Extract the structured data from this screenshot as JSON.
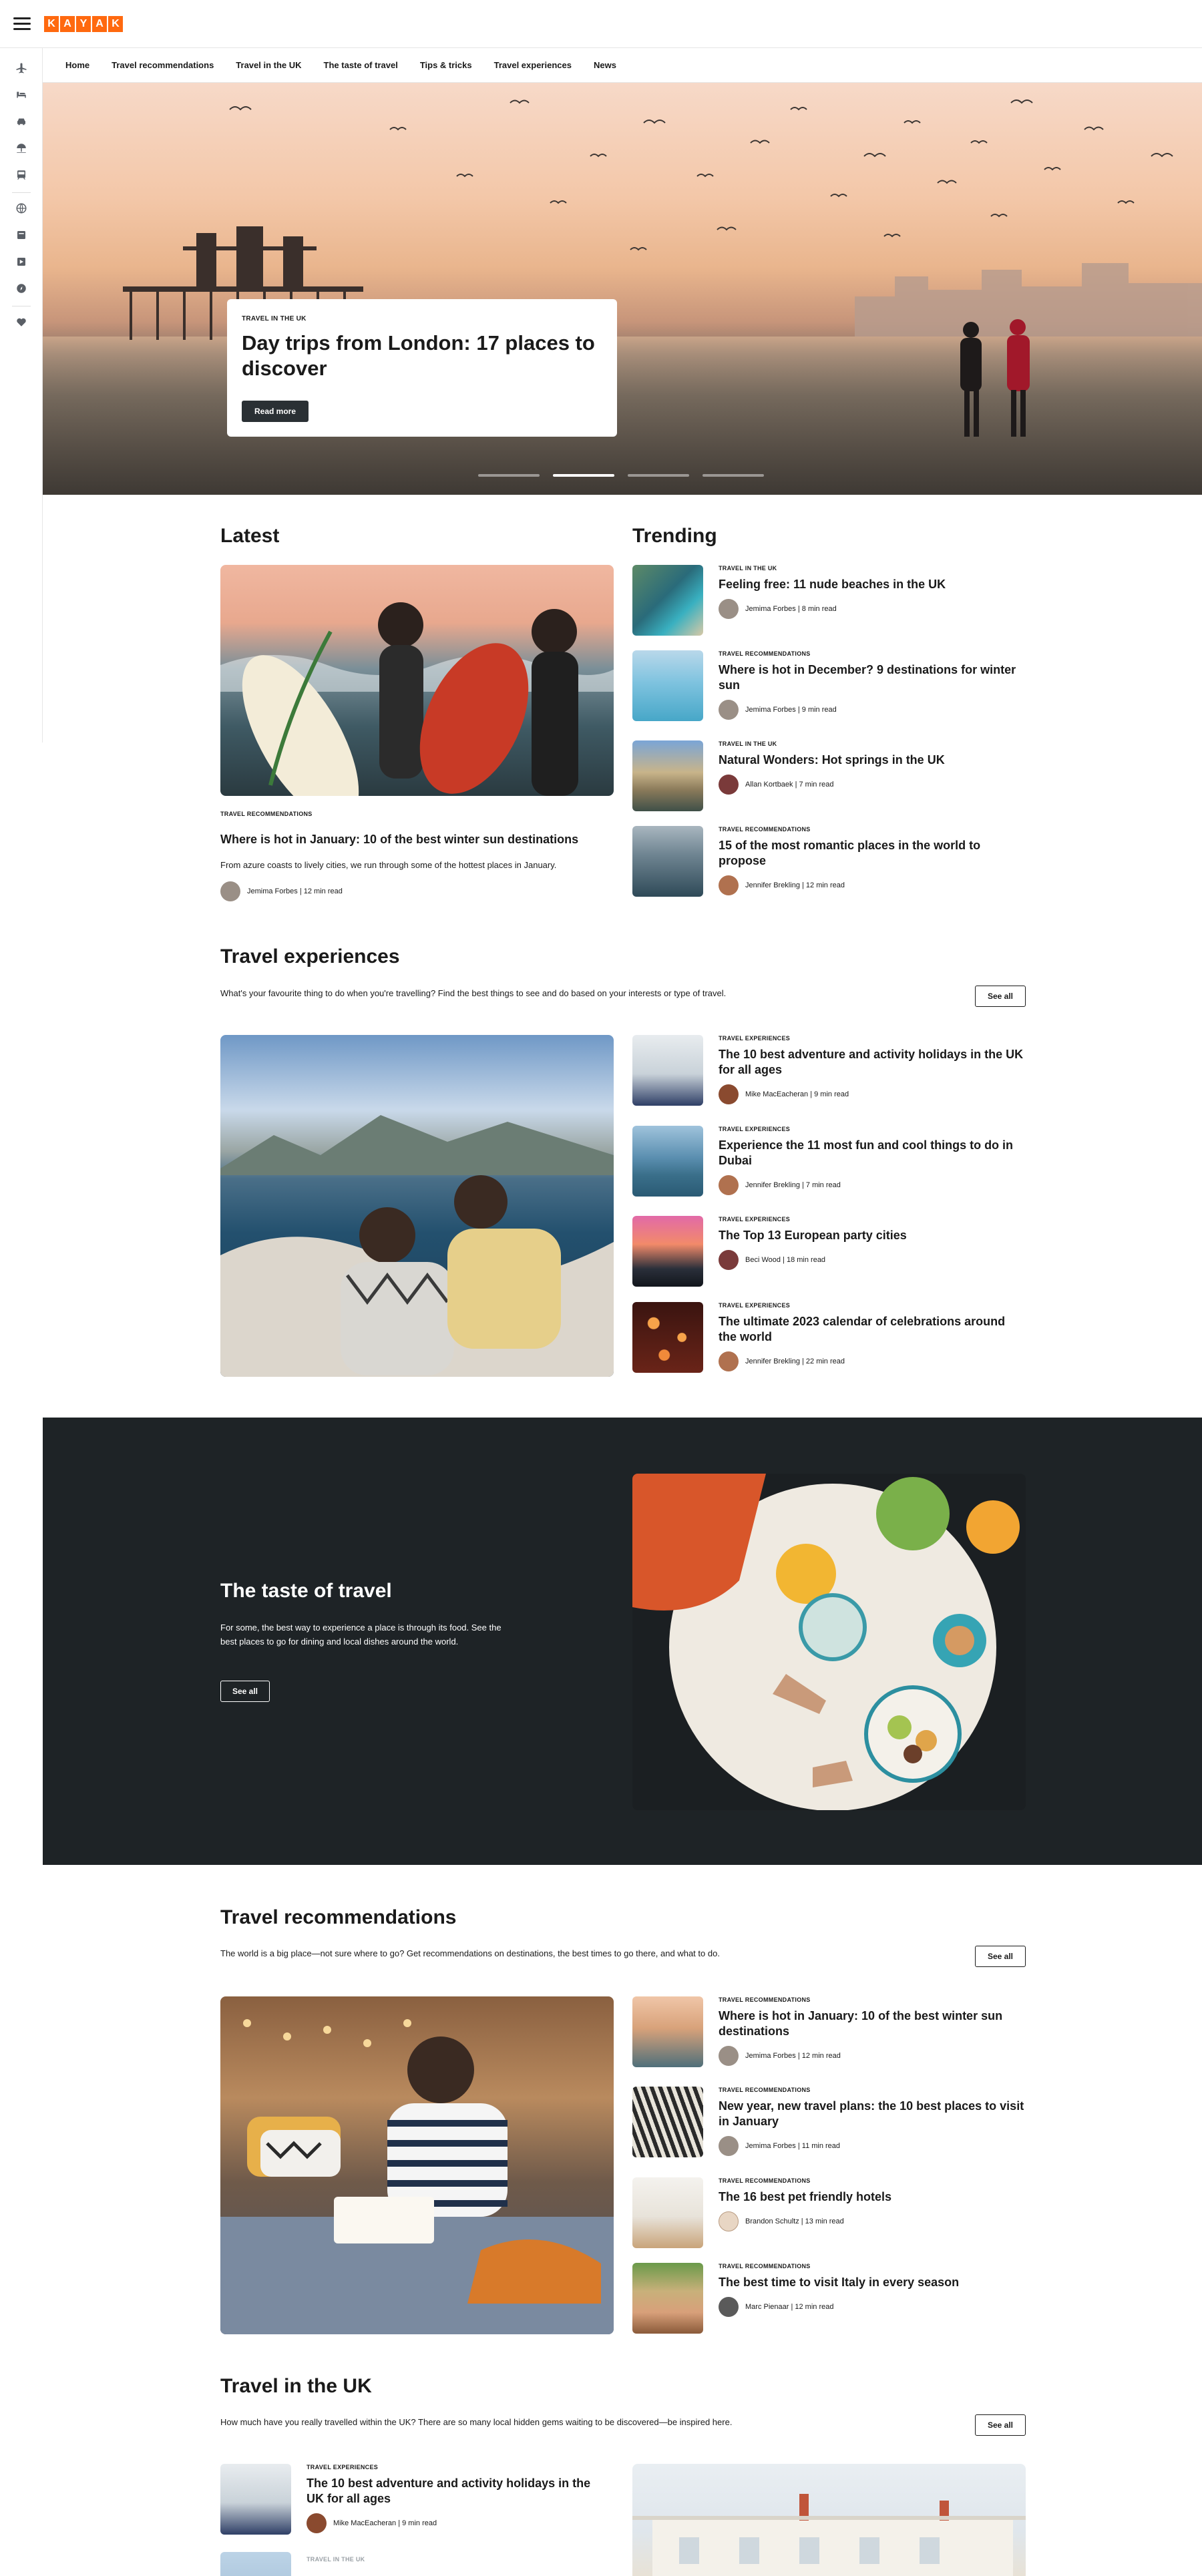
{
  "brand": {
    "letters": [
      "K",
      "A",
      "Y",
      "A",
      "K"
    ],
    "color": "#ff690f"
  },
  "rail_icons": [
    "plane-icon",
    "hotel-icon",
    "car-icon",
    "beach-icon",
    "train-icon",
    "globe-icon",
    "trips-icon",
    "explore-icon",
    "compass-icon",
    "heart-icon"
  ],
  "subnav": [
    "Home",
    "Travel recommendations",
    "Travel in the UK",
    "The taste of travel",
    "Tips & tricks",
    "Travel experiences",
    "News"
  ],
  "hero": {
    "kicker": "TRAVEL IN THE UK",
    "title": "Day trips from London: 17 places to discover",
    "button": "Read more",
    "slides": 4,
    "active_slide": 2
  },
  "latest": {
    "heading": "Latest",
    "kicker": "TRAVEL RECOMMENDATIONS",
    "title": "Where is hot in January: 10 of the best winter sun destinations",
    "desc": "From azure coasts to lively cities, we run through some of the hottest places in January.",
    "meta": "Jemima Forbes | 12 min read"
  },
  "trending": {
    "heading": "Trending",
    "items": [
      {
        "kicker": "TRAVEL IN THE UK",
        "title": "Feeling free: 11 nude beaches in the UK",
        "meta": "Jemima Forbes | 8 min read"
      },
      {
        "kicker": "TRAVEL RECOMMENDATIONS",
        "title": "Where is hot in December? 9 destinations for winter sun",
        "meta": "Jemima Forbes | 9 min read"
      },
      {
        "kicker": "TRAVEL IN THE UK",
        "title": "Natural Wonders: Hot springs in the UK",
        "meta": "Allan Kortbaek | 7 min read"
      },
      {
        "kicker": "TRAVEL RECOMMENDATIONS",
        "title": "15 of the most romantic places in the world to propose",
        "meta": "Jennifer Brekling | 12 min read"
      }
    ]
  },
  "experiences": {
    "heading": "Travel experiences",
    "intro": "What's your favourite thing to do when you're travelling? Find the best things to see and do based on your interests or type of travel.",
    "see_all": "See all",
    "items": [
      {
        "kicker": "TRAVEL EXPERIENCES",
        "title": "The 10 best adventure and activity holidays in the UK for all ages",
        "meta": "Mike MacEacheran | 9 min read"
      },
      {
        "kicker": "TRAVEL EXPERIENCES",
        "title": "Experience the 11 most fun and cool things to do in Dubai",
        "meta": "Jennifer Brekling | 7 min read"
      },
      {
        "kicker": "TRAVEL EXPERIENCES",
        "title": "The Top 13 European party cities",
        "meta": "Beci Wood | 18 min read"
      },
      {
        "kicker": "TRAVEL EXPERIENCES",
        "title": "The ultimate 2023 calendar of celebrations around the world",
        "meta": "Jennifer Brekling | 22 min read"
      }
    ]
  },
  "taste": {
    "heading": "The taste of travel",
    "text": "For some, the best way to experience a place is through its food. See the best places to go for dining and local dishes around the world.",
    "see_all": "See all"
  },
  "recommendations": {
    "heading": "Travel recommendations",
    "intro": "The world is a big place—not sure where to go? Get recommendations on destinations, the best times to go there, and what to do.",
    "see_all": "See all",
    "items": [
      {
        "kicker": "TRAVEL RECOMMENDATIONS",
        "title": "Where is hot in January: 10 of the best winter sun destinations",
        "meta": "Jemima Forbes | 12 min read"
      },
      {
        "kicker": "TRAVEL RECOMMENDATIONS",
        "title": "New year, new travel plans: the 10 best places to visit in January",
        "meta": "Jemima Forbes | 11 min read"
      },
      {
        "kicker": "TRAVEL RECOMMENDATIONS",
        "title": "The 16 best pet friendly hotels",
        "meta": "Brandon Schultz | 13 min read"
      },
      {
        "kicker": "TRAVEL RECOMMENDATIONS",
        "title": "The best time to visit Italy in every season",
        "meta": "Marc Pienaar | 12 min read"
      }
    ]
  },
  "uk": {
    "heading": "Travel in the UK",
    "intro": "How much have you really travelled within the UK? There are so many local hidden gems waiting to be discovered—be inspired here.",
    "see_all": "See all",
    "items": [
      {
        "kicker": "TRAVEL EXPERIENCES",
        "title": "The 10 best adventure and activity holidays in the UK for all ages",
        "meta": "Mike MacEacheran | 9 min read"
      },
      {
        "kicker": "TRAVEL IN THE UK",
        "title": "",
        "meta": ""
      }
    ]
  }
}
